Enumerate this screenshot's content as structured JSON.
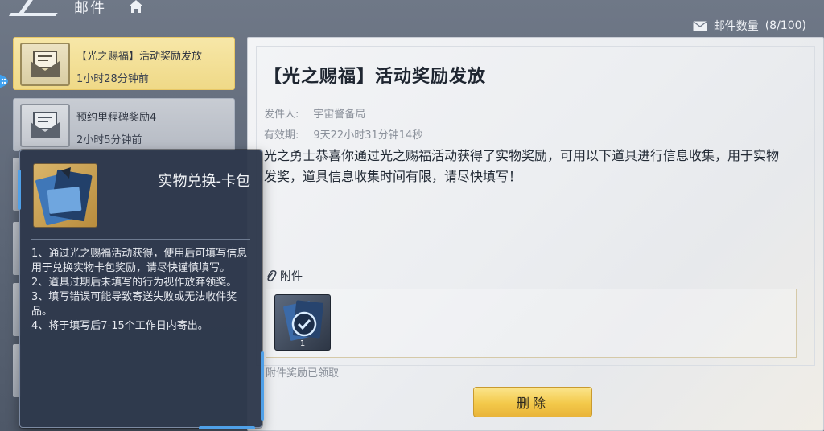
{
  "header": {
    "title": "邮件",
    "mail_count_label": "邮件数量",
    "mail_count_value": "(8/100)"
  },
  "mail_list": [
    {
      "subject": "【光之赐福】活动奖励发放",
      "time": "1小时28分钟前",
      "active": true
    },
    {
      "subject": "预约里程碑奖励4",
      "time": "2小时5分钟前",
      "active": false
    }
  ],
  "tooltip": {
    "title": "实物兑换-卡包",
    "lines": [
      "1、通过光之赐福活动获得，使用后可填写信息用于兑换实物卡包奖励，请尽快谨慎填写。",
      "2、道具过期后未填写的行为视作放弃领奖。",
      "3、填写错误可能导致寄送失败或无法收件奖品。",
      "4、将于填写后7-15个工作日内寄出。"
    ]
  },
  "mail": {
    "title": "【光之赐福】活动奖励发放",
    "sender_label": "发件人:",
    "sender": "宇宙警备局",
    "validity_label": "有效期:",
    "validity": "9天22小时31分钟14秒",
    "body": "光之勇士恭喜你通过光之赐福活动获得了实物奖励，可用以下道具进行信息收集，用于实物发奖，道具信息收集时间有限，请尽快填写！",
    "attachment_label": "附件",
    "attachment_qty": "1",
    "claimed_text": "附件奖励已领取",
    "delete_label": "删除"
  },
  "colors": {
    "active_item": "#f7e7a8",
    "tooltip_bg": "#2e394c",
    "accent_blue": "#4fa0e8",
    "delete_button": "#f3c94a"
  },
  "icons": [
    "back-slash-icon",
    "home-icon",
    "envelope-icon",
    "mail-thumb-icon",
    "card-pack-icon",
    "paperclip-icon",
    "check-circle-icon"
  ]
}
